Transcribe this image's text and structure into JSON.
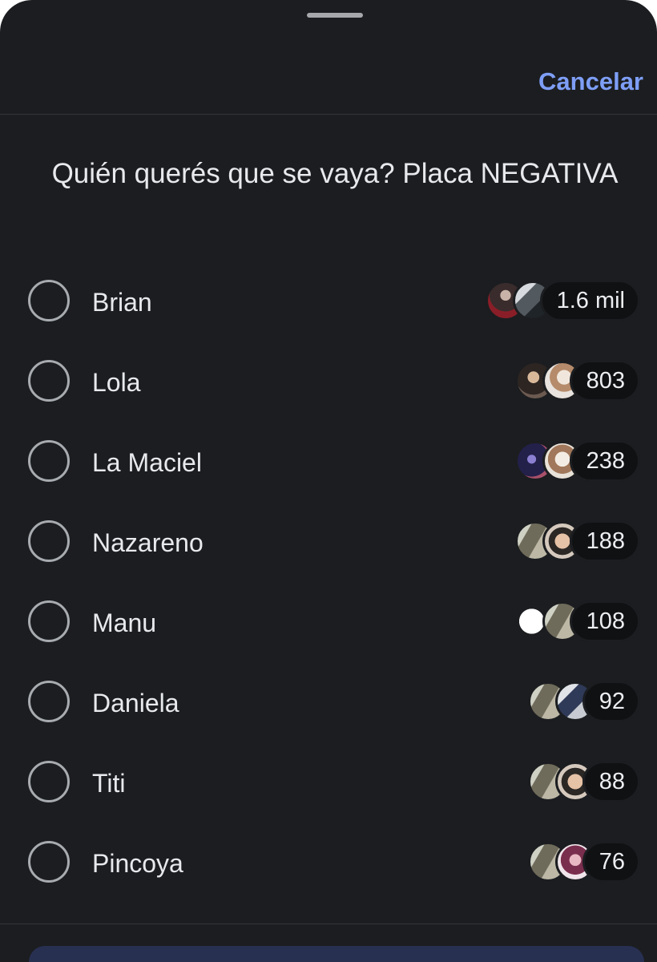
{
  "header": {
    "cancel_label": "Cancelar"
  },
  "poll": {
    "question": "Quién querés que se vaya? Placa NEGATIVA",
    "options": [
      {
        "label": "Brian",
        "count": "1.6 mil",
        "avatars": [
          "photo-a",
          "photo-b"
        ]
      },
      {
        "label": "Lola",
        "count": "803",
        "avatars": [
          "photo-c",
          "photo-d"
        ]
      },
      {
        "label": "La Maciel",
        "count": "238",
        "avatars": [
          "photo-e",
          "photo-f"
        ]
      },
      {
        "label": "Nazareno",
        "count": "188",
        "avatars": [
          "photo-g",
          "photo-h"
        ]
      },
      {
        "label": "Manu",
        "count": "108",
        "avatars": [
          "photo-i",
          "photo-g"
        ]
      },
      {
        "label": "Daniela",
        "count": "92",
        "avatars": [
          "photo-g",
          "photo-j"
        ]
      },
      {
        "label": "Titi",
        "count": "88",
        "avatars": [
          "photo-g",
          "photo-h"
        ]
      },
      {
        "label": "Pincoya",
        "count": "76",
        "avatars": [
          "photo-g",
          "photo-k"
        ]
      }
    ]
  },
  "colors": {
    "background": "#1b1d20",
    "accent": "#7e9ef6",
    "text": "#e7e9ec",
    "radio_border": "#a8abaf",
    "count_pill": "#101113"
  }
}
